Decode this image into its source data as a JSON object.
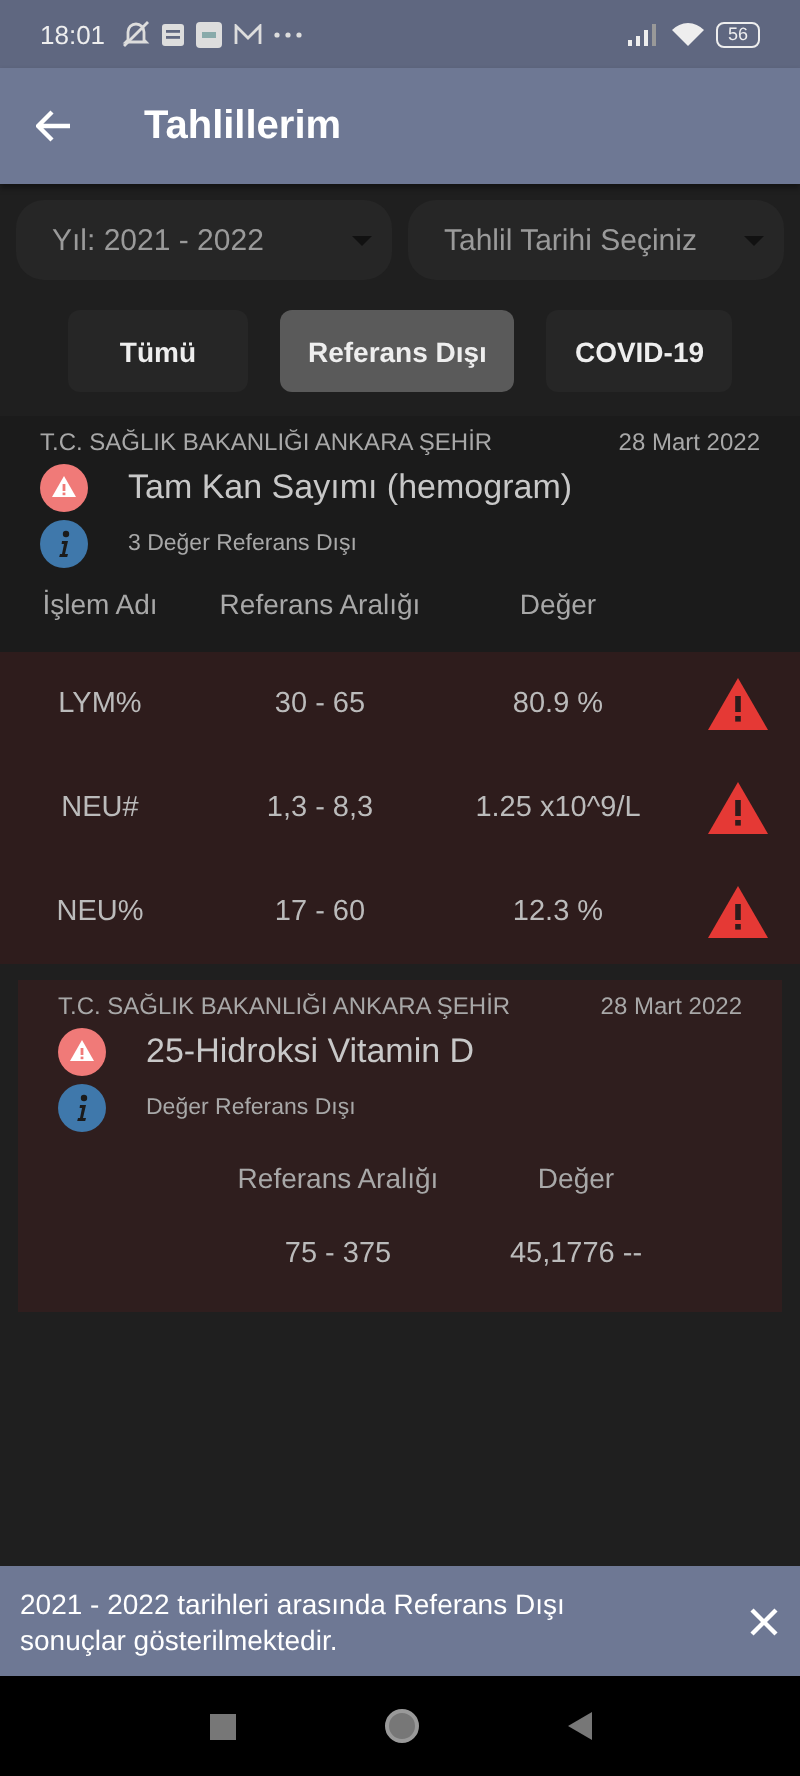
{
  "status_bar": {
    "time": "18:01",
    "battery": "56"
  },
  "app_bar": {
    "title": "Tahlillerim"
  },
  "dropdowns": [
    {
      "value": "Yıl: 2021 - 2022"
    },
    {
      "value": "Tahlil Tarihi Seçiniz"
    }
  ],
  "filters": [
    {
      "label": "Tümü",
      "selected": false
    },
    {
      "label": "Referans Dışı",
      "selected": true
    },
    {
      "label": "COVID-19",
      "selected": false
    }
  ],
  "results": [
    {
      "kind": "table",
      "hospital": "T.C. SAĞLIK BAKANLIĞI ANKARA ŞEHİR",
      "date": "28 Mart 2022",
      "test": "Tam Kan Sayımı (hemogram)",
      "summary": "3 Değer Referans Dışı",
      "columns": [
        "İşlem Adı",
        "Referans Aralığı",
        "Değer"
      ],
      "rows": [
        {
          "name": "LYM%",
          "range": "30 - 65",
          "value": "80.9 %",
          "flagged": true
        },
        {
          "name": "NEU#",
          "range": "1,3 - 8,3",
          "value": "1.25 x10^9/L",
          "flagged": true
        },
        {
          "name": "NEU%",
          "range": "17 - 60",
          "value": "12.3 %",
          "flagged": true
        }
      ]
    },
    {
      "kind": "single",
      "hospital": "T.C. SAĞLIK BAKANLIĞI ANKARA ŞEHİR",
      "date": "28 Mart 2022",
      "test": "25-Hidroksi Vitamin D",
      "summary": "Değer Referans Dışı",
      "columns": [
        "Referans Aralığı",
        "Değer"
      ],
      "rows": [
        {
          "range": "75 - 375",
          "value": "45,1776 --"
        }
      ]
    }
  ],
  "snackbar": {
    "message": "2021 - 2022 tarihleri arasında Referans Dışı sonuçlar gösterilmektedir."
  }
}
